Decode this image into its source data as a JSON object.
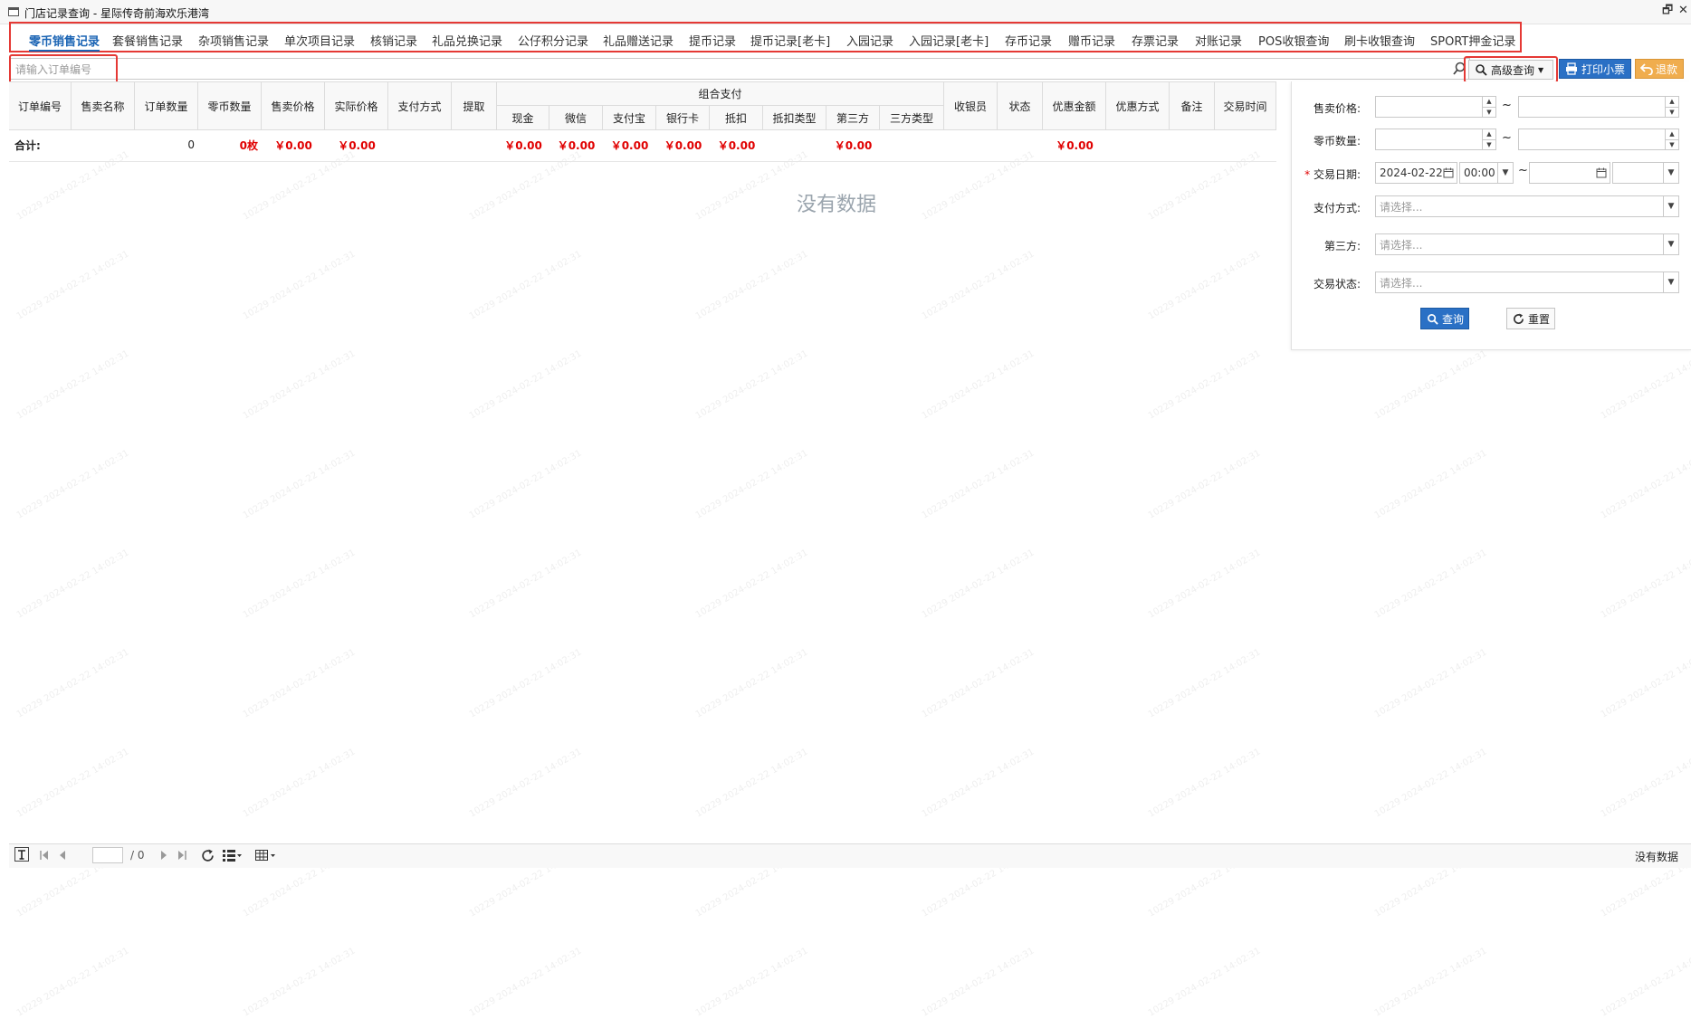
{
  "window": {
    "title": "门店记录查询 - 星际传奇前海欢乐港湾",
    "restore_label": "🗗",
    "close_label": "✕"
  },
  "tabs": [
    {
      "label": "零币销售记录",
      "active": true
    },
    {
      "label": "套餐销售记录"
    },
    {
      "label": "杂项销售记录"
    },
    {
      "label": "单次项目记录"
    },
    {
      "label": "核销记录"
    },
    {
      "label": "礼品兑换记录"
    },
    {
      "label": "公仔积分记录"
    },
    {
      "label": "礼品赠送记录"
    },
    {
      "label": "提币记录"
    },
    {
      "label": "提币记录[老卡]"
    },
    {
      "label": "入园记录"
    },
    {
      "label": "入园记录[老卡]"
    },
    {
      "label": "存币记录"
    },
    {
      "label": "赠币记录"
    },
    {
      "label": "存票记录"
    },
    {
      "label": "对账记录"
    },
    {
      "label": "POS收银查询"
    },
    {
      "label": "刷卡收银查询"
    },
    {
      "label": "SPORT押金记录"
    }
  ],
  "search": {
    "placeholder": "请输入订单编号"
  },
  "toolbar": {
    "advanced_label": "高级查询",
    "print_label": "打印小票",
    "refund_label": "退款"
  },
  "table": {
    "columns": [
      "订单编号",
      "售卖名称",
      "订单数量",
      "零币数量",
      "售卖价格",
      "实际价格",
      "支付方式",
      "提取",
      "组合支付",
      "收银员",
      "状态",
      "优惠金额",
      "优惠方式",
      "备注",
      "交易时间"
    ],
    "combo_subcolumns": [
      "现金",
      "微信",
      "支付宝",
      "银行卡",
      "抵扣",
      "抵扣类型",
      "第三方",
      "三方类型"
    ],
    "summary": {
      "label": "合计:",
      "order_qty": "0",
      "coin_qty": "0枚",
      "sale_price": "￥0.00",
      "actual_price": "￥0.00",
      "cash": "￥0.00",
      "wechat": "￥0.00",
      "alipay": "￥0.00",
      "bank_card": "￥0.00",
      "deduct": "￥0.00",
      "third_party": "￥0.00",
      "discount": "￥0.00"
    },
    "empty_text": "没有数据"
  },
  "filter_panel": {
    "price_label": "售卖价格:",
    "coin_qty_label": "零币数量:",
    "date_label": "交易日期:",
    "date_required_mark": "*",
    "date_from": "2024-02-22",
    "time_from": "00:00",
    "tilde": "~",
    "pay_method_label": "支付方式:",
    "third_party_label": "第三方:",
    "status_label": "交易状态:",
    "select_placeholder": "请选择...",
    "query_label": "查询",
    "reset_label": "重置"
  },
  "footer": {
    "page_value": "",
    "page_total": "/ 0",
    "status_text": "没有数据"
  },
  "watermark_text": "10229  2024-02-22 14:02:31",
  "colors": {
    "accent": "#1b64b4",
    "highlight_box": "#e53935",
    "primary_button": "#2a70c5",
    "warning_button": "#f0ad4e",
    "amount_red": "#e00000"
  }
}
